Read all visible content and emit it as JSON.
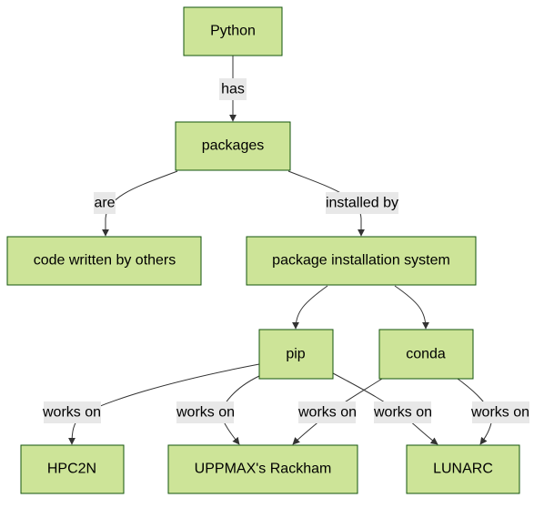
{
  "diagram": {
    "type": "flowchart",
    "direction": "top-down",
    "colors": {
      "node_fill": "#cde498",
      "node_stroke": "#13540c",
      "edge": "#333333",
      "label_bg": "#e8e8e8"
    },
    "nodes": [
      {
        "id": "python",
        "label": "Python"
      },
      {
        "id": "packages",
        "label": "packages"
      },
      {
        "id": "code",
        "label": "code written by others"
      },
      {
        "id": "pis",
        "label": "package installation system"
      },
      {
        "id": "pip",
        "label": "pip"
      },
      {
        "id": "conda",
        "label": "conda"
      },
      {
        "id": "hpc2n",
        "label": "HPC2N"
      },
      {
        "id": "uppmax",
        "label": "UPPMAX's Rackham"
      },
      {
        "id": "lunarc",
        "label": "LUNARC"
      }
    ],
    "edges": [
      {
        "from": "python",
        "to": "packages",
        "label": "has"
      },
      {
        "from": "packages",
        "to": "code",
        "label": "are"
      },
      {
        "from": "packages",
        "to": "pis",
        "label": "installed by"
      },
      {
        "from": "pis",
        "to": "pip",
        "label": ""
      },
      {
        "from": "pis",
        "to": "conda",
        "label": ""
      },
      {
        "from": "pip",
        "to": "hpc2n",
        "label": "works on"
      },
      {
        "from": "pip",
        "to": "uppmax",
        "label": "works on"
      },
      {
        "from": "conda",
        "to": "uppmax",
        "label": "works on"
      },
      {
        "from": "pip",
        "to": "lunarc",
        "label": "works on"
      },
      {
        "from": "conda",
        "to": "lunarc",
        "label": "works on"
      }
    ]
  }
}
